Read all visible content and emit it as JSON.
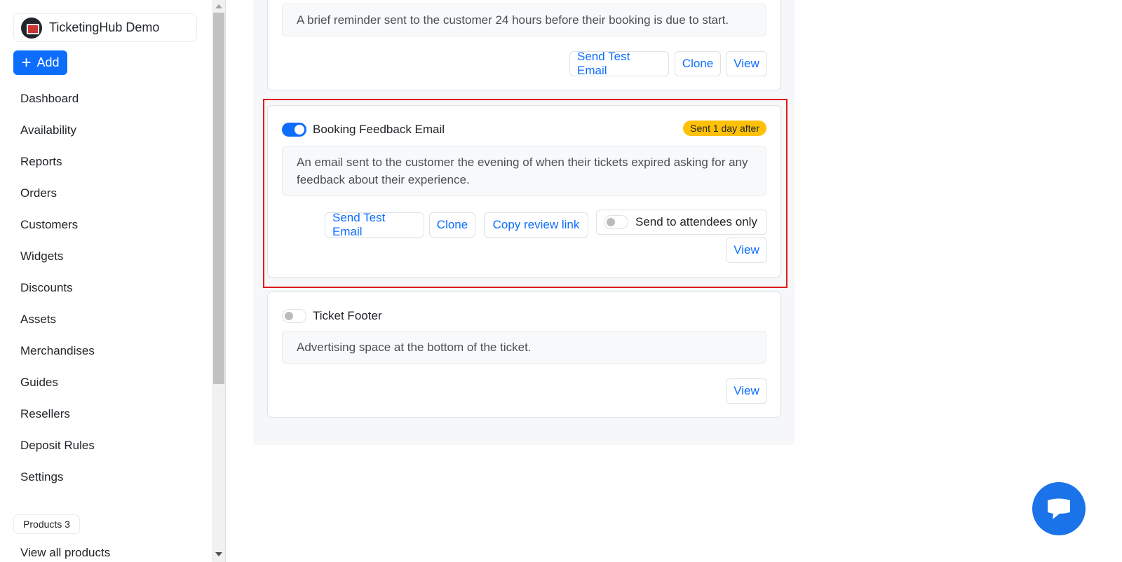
{
  "sidebar": {
    "org_name": "TicketingHub Demo",
    "add_label": "Add",
    "items": [
      "Dashboard",
      "Availability",
      "Reports",
      "Orders",
      "Customers",
      "Widgets",
      "Discounts",
      "Assets",
      "Merchandises",
      "Guides",
      "Resellers",
      "Deposit Rules",
      "Settings"
    ],
    "products_badge": "Products 3",
    "all_products": "View all products"
  },
  "cards": [
    {
      "description": "A brief reminder sent to the customer 24 hours before their booking is due to start.",
      "send_test": "Send Test Email",
      "clone": "Clone",
      "view": "View"
    },
    {
      "title": "Booking Feedback Email",
      "enabled": true,
      "badge": "Sent 1 day after",
      "description": "An email sent to the customer the evening of when their tickets expired asking for any feedback about their experience.",
      "send_test": "Send Test Email",
      "clone": "Clone",
      "copy_review": "Copy review link",
      "attendees_toggle": "Send to attendees only",
      "attendees_enabled": false,
      "view": "View"
    },
    {
      "title": "Ticket Footer",
      "enabled": false,
      "description": "Advertising space at the bottom of the ticket.",
      "view": "View"
    }
  ],
  "colors": {
    "primary": "#0d6efd",
    "badge": "#ffc107",
    "highlight": "#e01b1b"
  }
}
